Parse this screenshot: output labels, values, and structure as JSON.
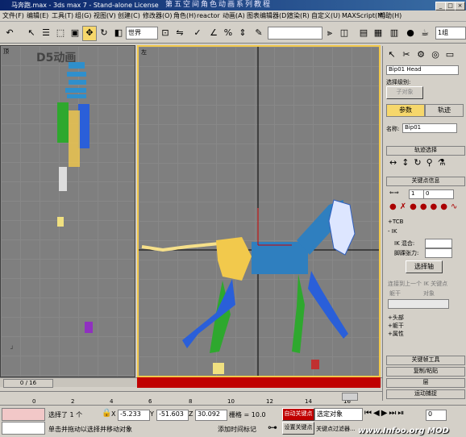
{
  "titlebar": {
    "text": "马奔跑.max - 3ds max 7 - Stand-alone License",
    "banner": "第五空间角色动画系列教程"
  },
  "menu": [
    "文件(F)",
    "编辑(E)",
    "工具(T)",
    "组(G)",
    "视图(V)",
    "创建(C)",
    "修改器(O)",
    "角色(H)",
    "reactor",
    "动画(A)",
    "图表编辑器(D)",
    "渲染(R)",
    "自定义(U)",
    "MAXScript(M)",
    "帮助(H)"
  ],
  "toolbar": {
    "coord_system": "世界",
    "named_selection": "",
    "right_value": "1组"
  },
  "viewports": {
    "left_label": "顶",
    "right_label": "左",
    "watermark": "D5动画"
  },
  "cmdpanel": {
    "object_name": "Bip01 Head",
    "selection_level_label": "选择级别:",
    "sub_object": "子对象",
    "tab_params": "参数",
    "tab_track": "轨迹",
    "name_label": "名称:",
    "name_value": "Bip01",
    "rollout_track_select": "轨迹选择",
    "rollout_key_info": "关键点信息",
    "key_value": "1",
    "key_spinner": "0",
    "tcb": "+TCB",
    "ik": "- IK",
    "ik_blend_label": "IK 混合:",
    "ankle_tension_label": "脚踝张力:",
    "select_pivot": "选择轴",
    "join_prev_ik": "连接到上一个 IK 关键点",
    "body_radio": "躯干",
    "object_radio": "对象",
    "head": "+头部",
    "spine": "+躯干",
    "props": "+属性",
    "rollout_key_tools": "关键帧工具",
    "rollout_copy_paste": "复制/粘贴",
    "rollout_layers": "层",
    "rollout_motion_capture": "运动捕捉"
  },
  "timeline": {
    "frame": "0 / 16",
    "ticks": [
      "0",
      "2",
      "4",
      "6",
      "8",
      "10",
      "12",
      "14",
      "16"
    ]
  },
  "statusbar": {
    "selected": "选择了 1 个",
    "x_value": "-5.233",
    "y_value": "-51.603",
    "z_value": "30.092",
    "grid": "栅格 = 10.0",
    "auto_key": "自动关键点",
    "selected_obj": "选定对象",
    "prompt": "单击并拖动以选择并移动对象",
    "add_time_tag": "添加时间标记",
    "set_key": "设置关键点",
    "key_filters": "关键点过滤器...",
    "frame_input": "0",
    "watermark": "www.Infoo.org MOD"
  },
  "colors": {
    "accent": "#f6d76b",
    "title": "#0a246a",
    "auto_key": "#c00000"
  }
}
